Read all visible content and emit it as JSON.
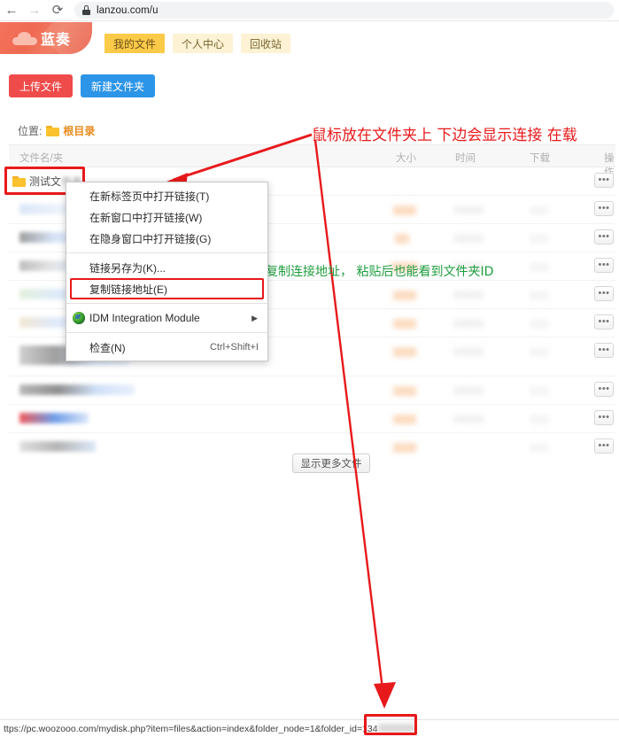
{
  "browser": {
    "back_icon": "back-arrow-icon",
    "forward_icon": "forward-arrow-icon",
    "reload_icon": "reload-icon",
    "lock_icon": "lock-icon",
    "url": "lanzou.com/u"
  },
  "header": {
    "logo_text": "蓝奏",
    "logo_icon": "cloud-icon",
    "tabs": [
      {
        "label": "我的文件",
        "active": true
      },
      {
        "label": "个人中心",
        "active": false
      },
      {
        "label": "回收站",
        "active": false
      }
    ]
  },
  "toolbar": {
    "upload_label": "上传文件",
    "newfolder_label": "新建文件夹"
  },
  "location": {
    "label": "位置:",
    "root": "根目录",
    "folder_icon": "folder-icon"
  },
  "table": {
    "headers": {
      "name": "文件名/夹",
      "size": "大小",
      "time": "时间",
      "download": "下载",
      "operation": "操作"
    },
    "selected_folder": {
      "name_visible": "测试文",
      "name_blurred": "件夹"
    },
    "op_button_label": "•••",
    "row_count": 11
  },
  "show_more": {
    "label": "显示更多文件"
  },
  "context_menu": {
    "items": [
      {
        "label": "在新标签页中打开链接(T)",
        "shortcut": "",
        "type": "item"
      },
      {
        "label": "在新窗口中打开链接(W)",
        "shortcut": "",
        "type": "item"
      },
      {
        "label": "在隐身窗口中打开链接(G)",
        "shortcut": "",
        "type": "item"
      },
      {
        "label": "",
        "shortcut": "",
        "type": "separator"
      },
      {
        "label": "链接另存为(K)...",
        "shortcut": "",
        "type": "item"
      },
      {
        "label": "复制链接地址(E)",
        "shortcut": "",
        "type": "item",
        "highlighted": true
      },
      {
        "label": "",
        "shortcut": "",
        "type": "separator"
      },
      {
        "label": "IDM Integration Module",
        "shortcut": "",
        "type": "item",
        "icon": "idm-globe-icon",
        "submenu": true
      },
      {
        "label": "",
        "shortcut": "",
        "type": "separator"
      },
      {
        "label": "检查(N)",
        "shortcut": "Ctrl+Shift+I",
        "type": "item"
      }
    ]
  },
  "annotations": {
    "red_note": "鼠标放在文件夹上  下边会显示连接  在载",
    "green_note": "或者复制连接地址，  粘贴后也能看到文件夹ID",
    "red_color": "#e8191b",
    "green_color": "#1f9e3f"
  },
  "status_bar": {
    "url": "ttps://pc.woozooo.com/mydisk.php?item=files&action=index&folder_node=1&folder_id=",
    "folder_id_visible": "134"
  }
}
